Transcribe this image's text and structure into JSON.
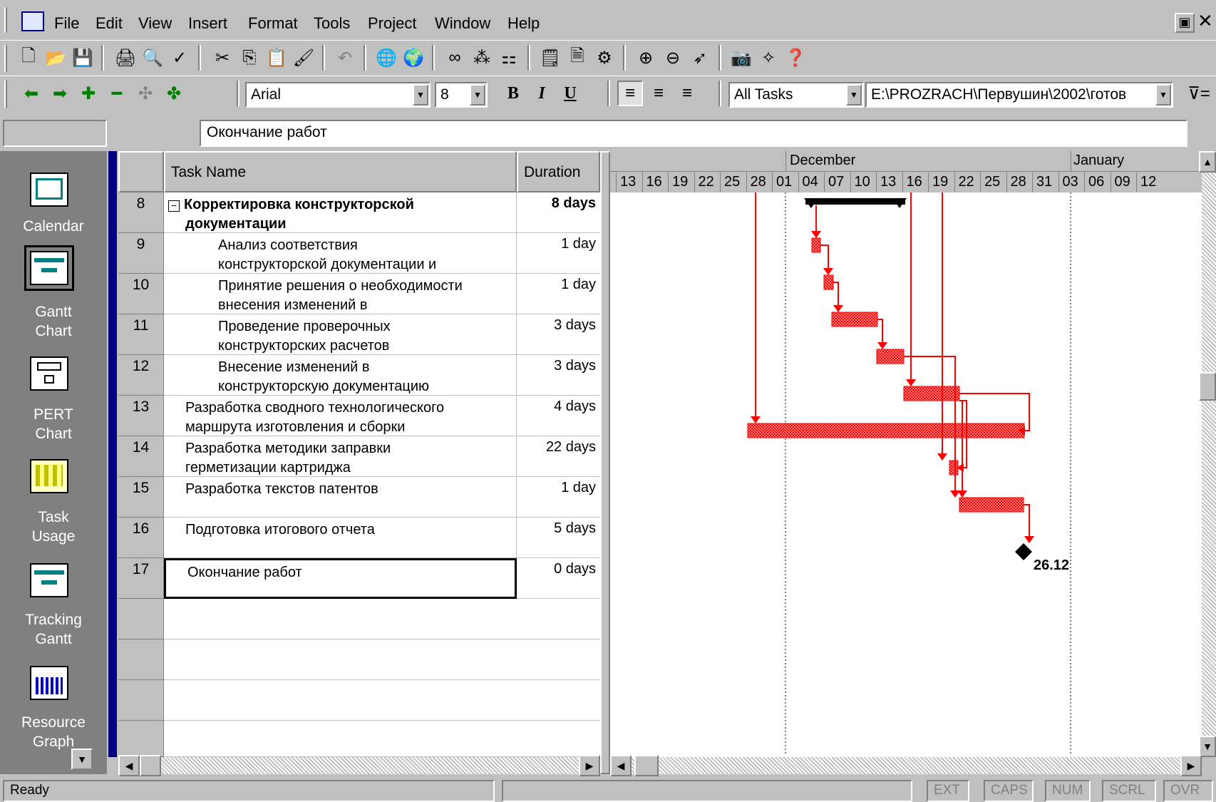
{
  "menu": {
    "items": [
      "File",
      "Edit",
      "View",
      "Insert",
      "Format",
      "Tools",
      "Project",
      "Window",
      "Help"
    ]
  },
  "format_toolbar": {
    "font": "Arial",
    "font_size": "8",
    "bold": "B",
    "italic": "I",
    "underline": "U",
    "filter": "All Tasks",
    "path": "E:\\PROZRACH\\Первушин\\2002\\готов"
  },
  "entry_bar": {
    "value": "Окончание работ"
  },
  "view_bar": {
    "items": [
      {
        "label_1": "Calendar",
        "label_2": ""
      },
      {
        "label_1": "Gantt",
        "label_2": "Chart"
      },
      {
        "label_1": "PERT",
        "label_2": "Chart"
      },
      {
        "label_1": "Task",
        "label_2": "Usage"
      },
      {
        "label_1": "Tracking",
        "label_2": "Gantt"
      },
      {
        "label_1": "Resource",
        "label_2": "Graph"
      }
    ]
  },
  "table": {
    "headers": {
      "name": "Task Name",
      "duration": "Duration"
    },
    "rows": [
      {
        "id": "8",
        "name_1": "Корректировка конструкторской",
        "name_2": "документации",
        "duration": "8 days"
      },
      {
        "id": "9",
        "name_1": "Анализ соответствия",
        "name_2": "конструкторской документации и",
        "duration": "1 day"
      },
      {
        "id": "10",
        "name_1": "Принятие решения о необходимости",
        "name_2": "внесения изменений в",
        "duration": "1 day"
      },
      {
        "id": "11",
        "name_1": "Проведение проверочных",
        "name_2": "конструкторских расчетов",
        "duration": "3 days"
      },
      {
        "id": "12",
        "name_1": "Внесение изменений в",
        "name_2": "конструкторскую документацию",
        "duration": "3 days"
      },
      {
        "id": "13",
        "name_1": "Разработка сводного технологического",
        "name_2": "маршрута изготовления и сборки",
        "duration": "4 days"
      },
      {
        "id": "14",
        "name_1": "Разработка методики заправки",
        "name_2": "герметизации картриджа",
        "duration": "22 days"
      },
      {
        "id": "15",
        "name_1": "Разработка текстов патентов",
        "name_2": "",
        "duration": "1 day"
      },
      {
        "id": "16",
        "name_1": "Подготовка итогового отчета",
        "name_2": "",
        "duration": "5 days"
      },
      {
        "id": "17",
        "name_1": "Окончание работ",
        "name_2": "",
        "duration": "0 days"
      }
    ]
  },
  "timescale": {
    "months": [
      "December",
      "January"
    ],
    "days": [
      "13",
      "16",
      "19",
      "22",
      "25",
      "28",
      "01",
      "04",
      "07",
      "10",
      "13",
      "16",
      "19",
      "22",
      "25",
      "28",
      "31",
      "03",
      "06",
      "09",
      "12"
    ]
  },
  "milestone_label": "26.12",
  "status": {
    "ready": "Ready",
    "indicators": [
      "EXT",
      "CAPS",
      "NUM",
      "SCRL",
      "OVR"
    ]
  },
  "colors": {
    "bar": "#ff0000",
    "summary": "#000000",
    "viewbar": "#808080"
  }
}
